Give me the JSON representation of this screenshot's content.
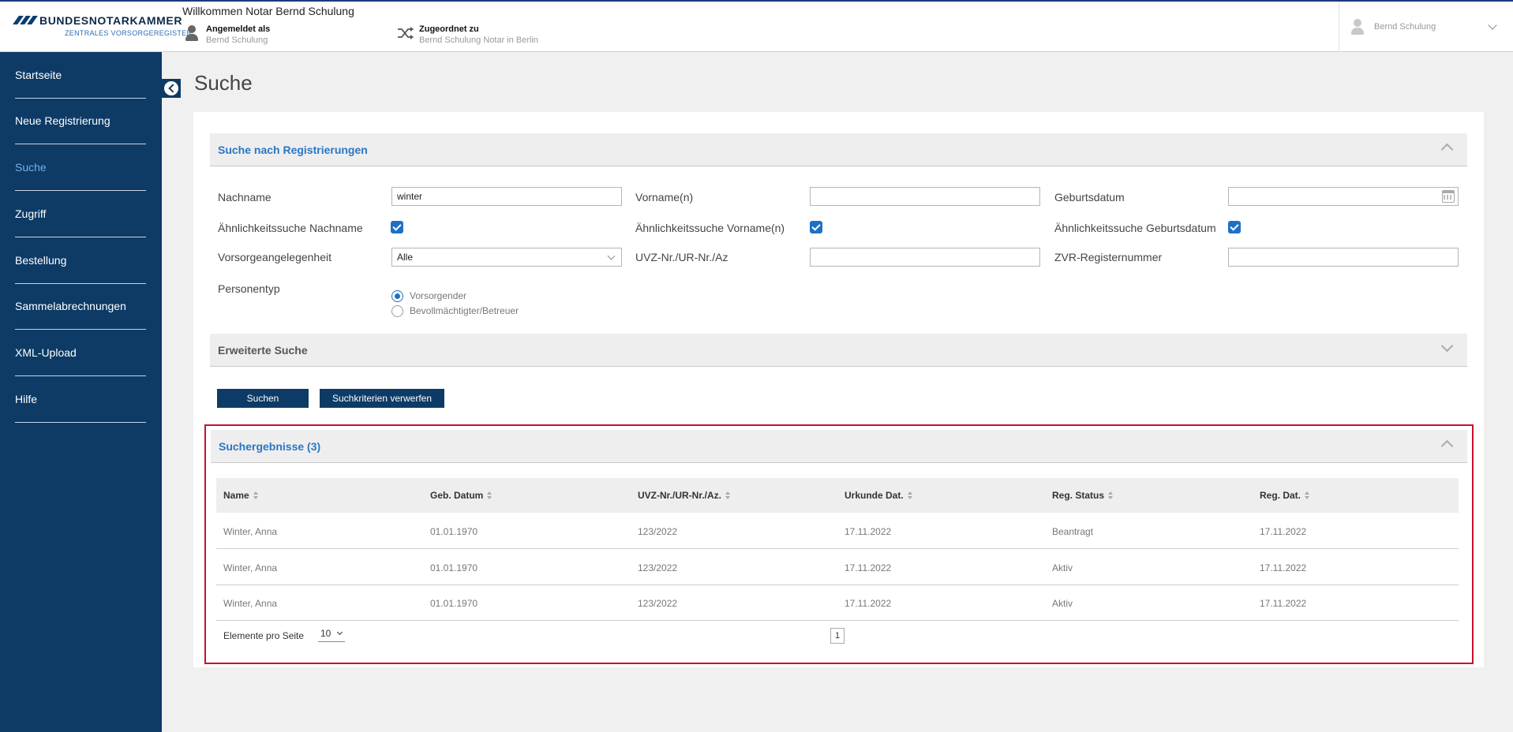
{
  "header": {
    "logo": {
      "main": "BUNDESNOTARKAMMER",
      "sub": "ZENTRALES VORSORGEREGISTER"
    },
    "welcome": "Willkommen Notar Bernd Schulung",
    "logged_in": {
      "label": "Angemeldet als",
      "value": "Bernd Schulung"
    },
    "assigned": {
      "label": "Zugeordnet zu",
      "value": "Bernd Schulung Notar in Berlin"
    },
    "user_menu": {
      "name": "Bernd Schulung"
    }
  },
  "sidebar": {
    "items": [
      {
        "label": "Startseite",
        "active": false
      },
      {
        "label": "Neue Registrierung",
        "active": false
      },
      {
        "label": "Suche",
        "active": true
      },
      {
        "label": "Zugriff",
        "active": false
      },
      {
        "label": "Bestellung",
        "active": false
      },
      {
        "label": "Sammelabrechnungen",
        "active": false
      },
      {
        "label": "XML-Upload",
        "active": false
      },
      {
        "label": "Hilfe",
        "active": false
      }
    ]
  },
  "page": {
    "title": "Suche"
  },
  "search": {
    "panel_title": "Suche nach Registrierungen",
    "nachname": {
      "label": "Nachname",
      "value": "winter"
    },
    "vorname": {
      "label": "Vorname(n)",
      "value": ""
    },
    "geburtsdatum": {
      "label": "Geburtsdatum",
      "value": ""
    },
    "aehnlich_nachname": {
      "label": "Ähnlichkeitssuche Nachname",
      "checked": true
    },
    "aehnlich_vorname": {
      "label": "Ähnlichkeitssuche Vorname(n)",
      "checked": true
    },
    "aehnlich_geburtsdatum": {
      "label": "Ähnlichkeitssuche Geburtsdatum",
      "checked": true
    },
    "vorsorge": {
      "label": "Vorsorgeangelegenheit",
      "value": "Alle"
    },
    "uvz": {
      "label": "UVZ-Nr./UR-Nr./Az",
      "value": ""
    },
    "zvr": {
      "label": "ZVR-Registernummer",
      "value": ""
    },
    "personentyp": {
      "label": "Personentyp",
      "options": [
        {
          "label": "Vorsorgender",
          "selected": true
        },
        {
          "label": "Bevollmächtigter/Betreuer",
          "selected": false
        }
      ]
    },
    "extended_title": "Erweiterte Suche",
    "search_button": "Suchen",
    "reset_button": "Suchkriterien verwerfen"
  },
  "results": {
    "title": "Suchergebnisse (3)",
    "columns": [
      "Name",
      "Geb. Datum",
      "UVZ-Nr./UR-Nr./Az.",
      "Urkunde Dat.",
      "Reg. Status",
      "Reg. Dat."
    ],
    "rows": [
      [
        "Winter, Anna",
        "01.01.1970",
        "123/2022",
        "17.11.2022",
        "Beantragt",
        "17.11.2022"
      ],
      [
        "Winter, Anna",
        "01.01.1970",
        "123/2022",
        "17.11.2022",
        "Aktiv",
        "17.11.2022"
      ],
      [
        "Winter, Anna",
        "01.01.1970",
        "123/2022",
        "17.11.2022",
        "Aktiv",
        "17.11.2022"
      ]
    ],
    "per_page_label": "Elemente pro Seite",
    "per_page_value": "10",
    "current_page": "1"
  },
  "colors": {
    "navy": "#0d3b66",
    "accent_blue": "#2a76c4",
    "highlight_red": "#c8102e"
  }
}
